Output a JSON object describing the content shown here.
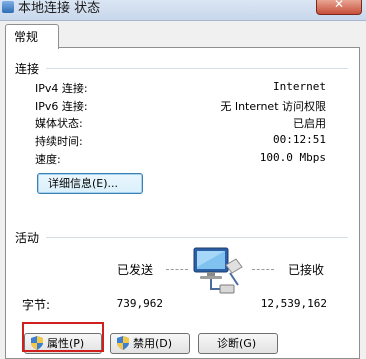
{
  "window": {
    "title": "本地连接 状态",
    "close_label": "✕"
  },
  "tabs": [
    {
      "label": "常规"
    }
  ],
  "connection": {
    "title": "连接",
    "rows": [
      {
        "label": "IPv4 连接:",
        "value": "Internet"
      },
      {
        "label": "IPv6 连接:",
        "value": "无 Internet 访问权限"
      },
      {
        "label": "媒体状态:",
        "value": "已启用"
      },
      {
        "label": "持续时间:",
        "value": "00:12:51"
      },
      {
        "label": "速度:",
        "value": "100.0 Mbps"
      }
    ],
    "details_button": "详细信息(E)..."
  },
  "activity": {
    "title": "活动",
    "sent_label": "已发送",
    "received_label": "已接收",
    "bytes_label": "字节:",
    "bytes_sent": "739,962",
    "bytes_received": "12,539,162"
  },
  "buttons": {
    "properties": "属性(P)",
    "disable": "禁用(D)",
    "diagnose": "诊断(G)"
  }
}
